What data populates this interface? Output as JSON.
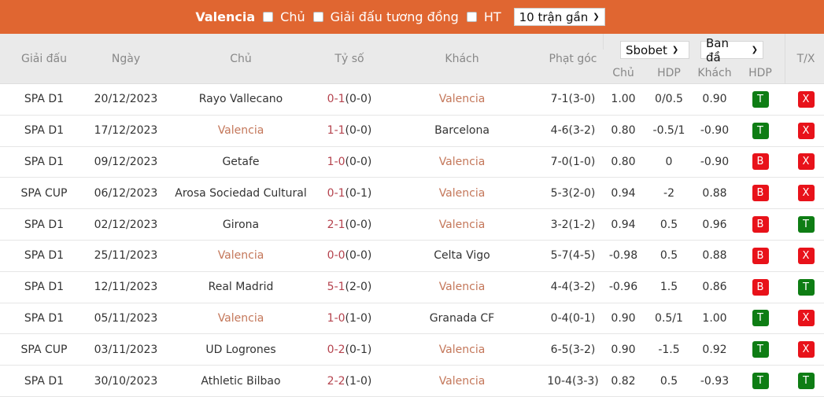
{
  "topbar": {
    "team": "Valencia",
    "options": [
      {
        "label": "Chủ",
        "checked": false
      },
      {
        "label": "Giải đấu tương đồng",
        "checked": false
      },
      {
        "label": "HT",
        "checked": false
      }
    ],
    "range_select": "10 trận gần"
  },
  "header": {
    "league": "Giải đấu",
    "date": "Ngày",
    "home": "Chủ",
    "score": "Tỷ số",
    "away": "Khách",
    "corner": "Phạt góc",
    "bookmaker_select": "Sbobet",
    "odds_type_select": "Ban đầ",
    "home_odds": "Chủ",
    "hdp": "HDP",
    "away_odds": "Khách",
    "hdp_result": "HDP",
    "tx": "T/X"
  },
  "colors": {
    "brand": "#e06631",
    "highlight_team": "#c4775a",
    "score": "#b5434e",
    "win_badge": "#0e7d14",
    "loss_badge": "#e8121a"
  },
  "rows": [
    {
      "league": "SPA D1",
      "date": "20/12/2023",
      "home": "Rayo Vallecano",
      "home_hl": false,
      "score_ft": "0-1",
      "score_ht": "(0-0)",
      "away": "Valencia",
      "away_hl": true,
      "corner": "7-1(3-0)",
      "home_odds": "1.00",
      "hdp": "0/0.5",
      "away_odds": "0.90",
      "hdp_result": "T",
      "tx": "X"
    },
    {
      "league": "SPA D1",
      "date": "17/12/2023",
      "home": "Valencia",
      "home_hl": true,
      "score_ft": "1-1",
      "score_ht": "(0-0)",
      "away": "Barcelona",
      "away_hl": false,
      "corner": "4-6(3-2)",
      "home_odds": "0.80",
      "hdp": "-0.5/1",
      "away_odds": "-0.90",
      "hdp_result": "T",
      "tx": "X"
    },
    {
      "league": "SPA D1",
      "date": "09/12/2023",
      "home": "Getafe",
      "home_hl": false,
      "score_ft": "1-0",
      "score_ht": "(0-0)",
      "away": "Valencia",
      "away_hl": true,
      "corner": "7-0(1-0)",
      "home_odds": "0.80",
      "hdp": "0",
      "away_odds": "-0.90",
      "hdp_result": "B",
      "tx": "X"
    },
    {
      "league": "SPA CUP",
      "date": "06/12/2023",
      "home": "Arosa Sociedad Cultural",
      "home_hl": false,
      "score_ft": "0-1",
      "score_ht": "(0-1)",
      "away": "Valencia",
      "away_hl": true,
      "corner": "5-3(2-0)",
      "home_odds": "0.94",
      "hdp": "-2",
      "away_odds": "0.88",
      "hdp_result": "B",
      "tx": "X"
    },
    {
      "league": "SPA D1",
      "date": "02/12/2023",
      "home": "Girona",
      "home_hl": false,
      "score_ft": "2-1",
      "score_ht": "(0-0)",
      "away": "Valencia",
      "away_hl": true,
      "corner": "3-2(1-2)",
      "home_odds": "0.94",
      "hdp": "0.5",
      "away_odds": "0.96",
      "hdp_result": "B",
      "tx": "T"
    },
    {
      "league": "SPA D1",
      "date": "25/11/2023",
      "home": "Valencia",
      "home_hl": true,
      "score_ft": "0-0",
      "score_ht": "(0-0)",
      "away": "Celta Vigo",
      "away_hl": false,
      "corner": "5-7(4-5)",
      "home_odds": "-0.98",
      "hdp": "0.5",
      "away_odds": "0.88",
      "hdp_result": "B",
      "tx": "X"
    },
    {
      "league": "SPA D1",
      "date": "12/11/2023",
      "home": "Real Madrid",
      "home_hl": false,
      "score_ft": "5-1",
      "score_ht": "(2-0)",
      "away": "Valencia",
      "away_hl": true,
      "corner": "4-4(3-2)",
      "home_odds": "-0.96",
      "hdp": "1.5",
      "away_odds": "0.86",
      "hdp_result": "B",
      "tx": "T"
    },
    {
      "league": "SPA D1",
      "date": "05/11/2023",
      "home": "Valencia",
      "home_hl": true,
      "score_ft": "1-0",
      "score_ht": "(1-0)",
      "away": "Granada CF",
      "away_hl": false,
      "corner": "0-4(0-1)",
      "home_odds": "0.90",
      "hdp": "0.5/1",
      "away_odds": "1.00",
      "hdp_result": "T",
      "tx": "X"
    },
    {
      "league": "SPA CUP",
      "date": "03/11/2023",
      "home": "UD Logrones",
      "home_hl": false,
      "score_ft": "0-2",
      "score_ht": "(0-1)",
      "away": "Valencia",
      "away_hl": true,
      "corner": "6-5(3-2)",
      "home_odds": "0.90",
      "hdp": "-1.5",
      "away_odds": "0.92",
      "hdp_result": "T",
      "tx": "X"
    },
    {
      "league": "SPA D1",
      "date": "30/10/2023",
      "home": "Athletic Bilbao",
      "home_hl": false,
      "score_ft": "2-2",
      "score_ht": "(1-0)",
      "away": "Valencia",
      "away_hl": true,
      "corner": "10-4(3-3)",
      "home_odds": "0.82",
      "hdp": "0.5",
      "away_odds": "-0.93",
      "hdp_result": "T",
      "tx": "T"
    }
  ]
}
